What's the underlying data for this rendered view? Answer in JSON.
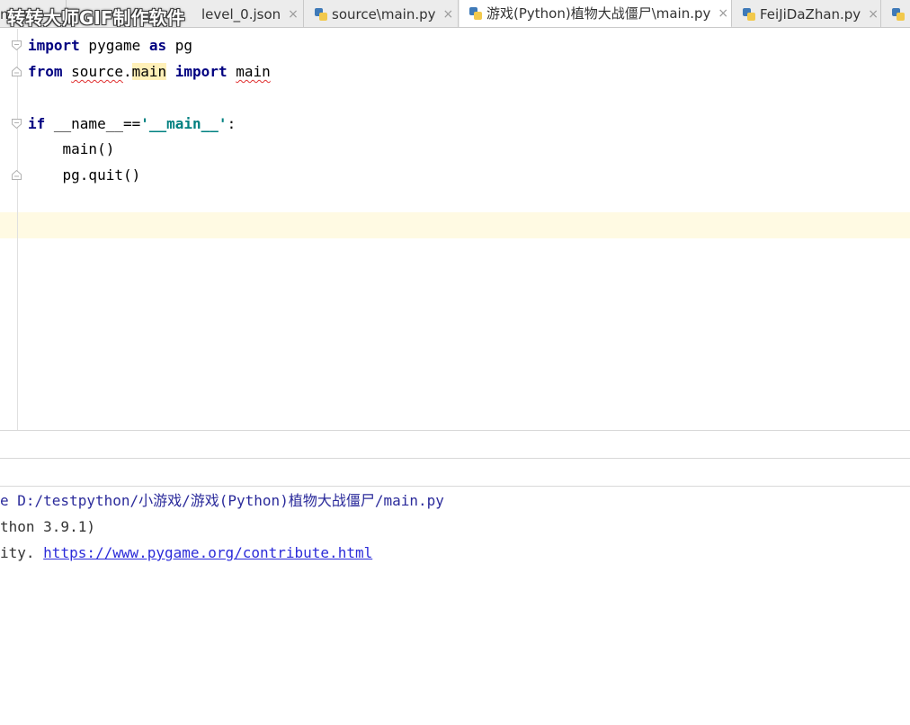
{
  "watermark": "转转大师GIF制作软件",
  "tabs": [
    {
      "label": "n",
      "icon": "json-icon",
      "closable": false,
      "active": false
    },
    {
      "label": "level_0.json",
      "icon": "json-icon",
      "closable": true,
      "active": false
    },
    {
      "label": "source\\main.py",
      "icon": "python-file-icon",
      "closable": true,
      "active": false
    },
    {
      "label": "游戏(Python)植物大战僵尸\\main.py",
      "icon": "python-file-icon",
      "closable": true,
      "active": true
    },
    {
      "label": "FeiJiDaZhan.py",
      "icon": "python-file-icon",
      "closable": true,
      "active": false
    }
  ],
  "close_glyph": "×",
  "editor": {
    "lines": [
      {
        "segments": [
          {
            "t": "import",
            "s": "kw"
          },
          {
            "t": " pygame ",
            "s": ""
          },
          {
            "t": "as",
            "s": "kw"
          },
          {
            "t": " pg",
            "s": ""
          }
        ]
      },
      {
        "segments": [
          {
            "t": "from",
            "s": "kw"
          },
          {
            "t": " ",
            "s": ""
          },
          {
            "t": "source",
            "s": "squig"
          },
          {
            "t": ".",
            "s": ""
          },
          {
            "t": "main",
            "s": "hl"
          },
          {
            "t": " ",
            "s": ""
          },
          {
            "t": "import",
            "s": "kw"
          },
          {
            "t": " ",
            "s": ""
          },
          {
            "t": "main",
            "s": "squig"
          }
        ]
      },
      {
        "segments": []
      },
      {
        "segments": [
          {
            "t": "if",
            "s": "kw"
          },
          {
            "t": " __name__==",
            "s": ""
          },
          {
            "t": "'__main__'",
            "s": "str"
          },
          {
            "t": ":",
            "s": ""
          }
        ]
      },
      {
        "segments": [
          {
            "t": "    main()",
            "s": ""
          }
        ]
      },
      {
        "segments": [
          {
            "t": "    pg.quit()",
            "s": ""
          }
        ]
      }
    ]
  },
  "console": {
    "lines": [
      {
        "text": "e D:/testpython/小游戏/游戏(Python)植物大战僵尸/main.py",
        "style": "con-cmd"
      },
      {
        "text": "thon 3.9.1)",
        "style": "con-out"
      },
      {
        "prefix": "ity. ",
        "link": "https://www.pygame.org/contribute.html",
        "style": "con-out"
      }
    ]
  },
  "colors": {
    "keyword": "#000080",
    "string": "#008080",
    "current_line": "#fffae3",
    "link": "#2b2bd9"
  }
}
